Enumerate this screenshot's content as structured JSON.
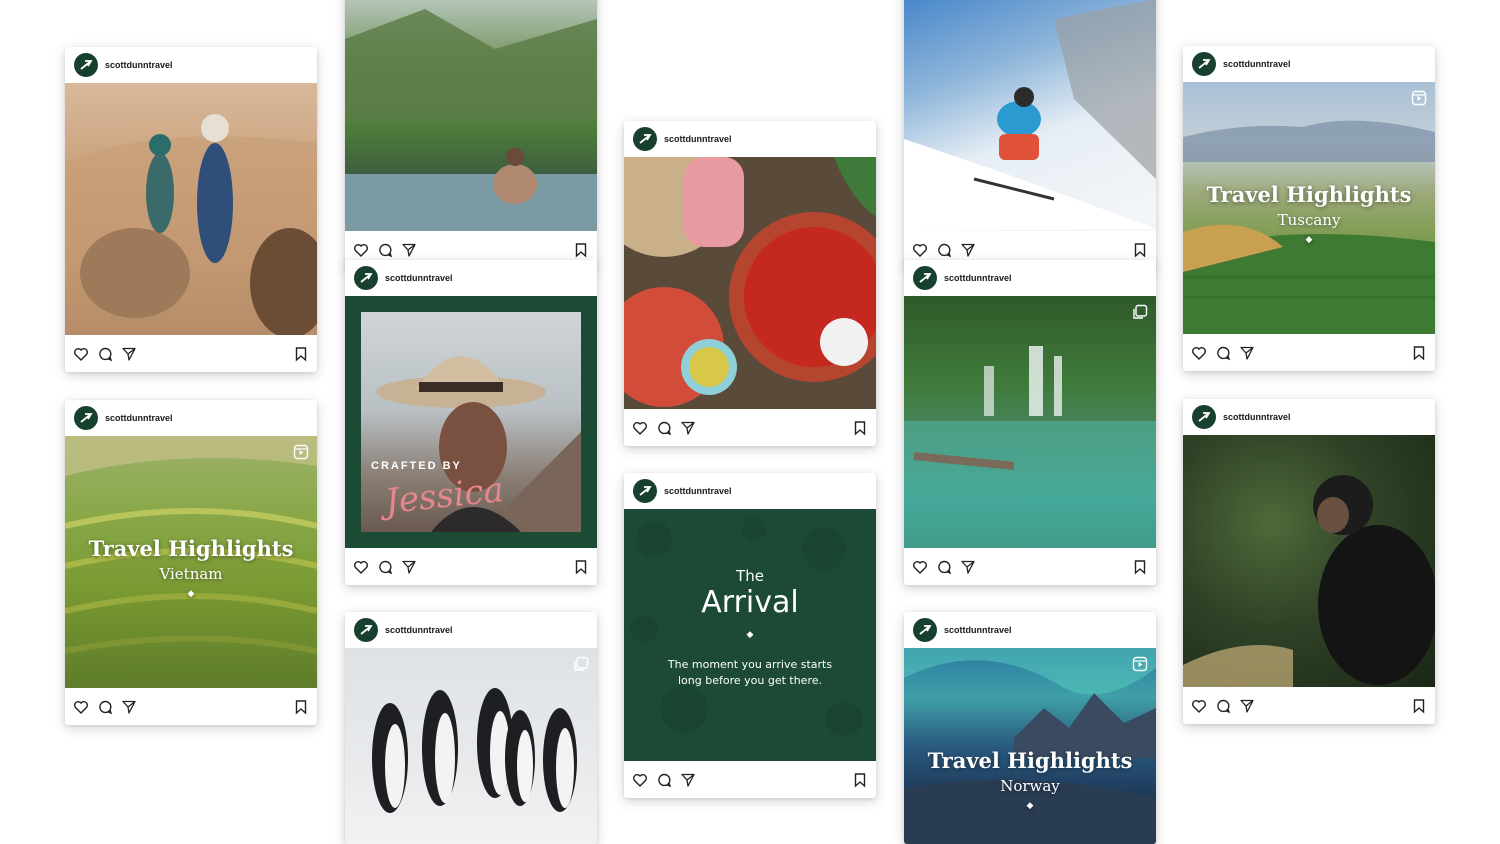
{
  "account": {
    "username": "scottdunntravel"
  },
  "posts": [
    {
      "id": "desert",
      "overlay": null
    },
    {
      "id": "vietnam",
      "overlay": {
        "title": "Travel Highlights",
        "subtitle": "Vietnam"
      }
    },
    {
      "id": "pool",
      "overlay": null
    },
    {
      "id": "crafted",
      "overlay": {
        "kicker": "CRAFTED BY",
        "signature": "Jessica"
      }
    },
    {
      "id": "penguins",
      "overlay": null
    },
    {
      "id": "chillies",
      "overlay": null
    },
    {
      "id": "arrival",
      "overlay": {
        "the": "The",
        "title": "Arrival",
        "body_line1": "The moment you arrive starts",
        "body_line2": "long before you get there."
      }
    },
    {
      "id": "skier",
      "overlay": null
    },
    {
      "id": "waterfall",
      "overlay": null
    },
    {
      "id": "norway",
      "overlay": {
        "title": "Travel Highlights",
        "subtitle": "Norway"
      }
    },
    {
      "id": "tuscany",
      "overlay": {
        "title": "Travel Highlights",
        "subtitle": "Tuscany"
      }
    },
    {
      "id": "chimp",
      "overlay": null
    }
  ],
  "icons": {
    "like": "heart-icon",
    "comment": "comment-icon",
    "share": "share-icon",
    "save": "bookmark-icon",
    "reel": "reel-icon",
    "carousel": "carousel-icon"
  },
  "colors": {
    "brand_green": "#17402f",
    "arrival_green": "#1d4a36"
  }
}
